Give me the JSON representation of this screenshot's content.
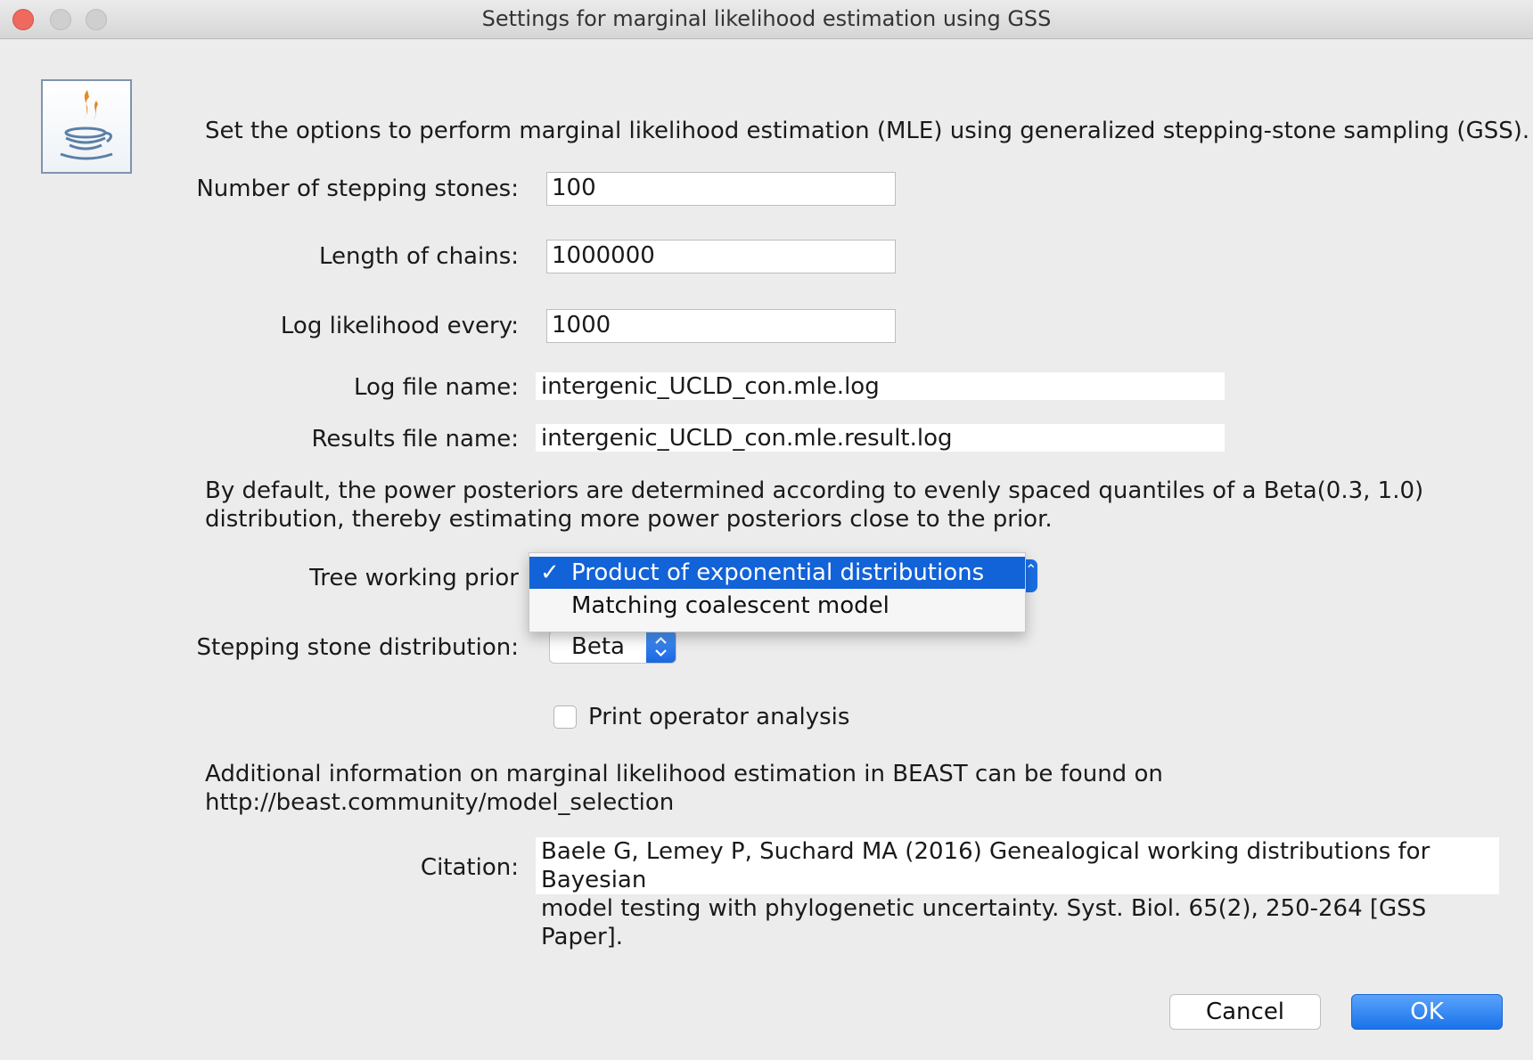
{
  "window": {
    "title": "Settings for marginal likelihood estimation using GSS"
  },
  "intro": "Set the options to perform marginal likelihood estimation (MLE) using generalized stepping-stone sampling (GSS).",
  "fields": {
    "stepping_stones": {
      "label": "Number of stepping stones:",
      "value": "100"
    },
    "chain_length": {
      "label": "Length of chains:",
      "value": "1000000"
    },
    "log_every": {
      "label": "Log likelihood every:",
      "value": "1000"
    },
    "log_file": {
      "label": "Log file name:",
      "value": "intergenic_UCLD_con.mle.log"
    },
    "results_file": {
      "label": "Results file name:",
      "value": "intergenic_UCLD_con.mle.result.log"
    }
  },
  "default_note": {
    "line1": "By default, the power posteriors are determined according to evenly spaced quantiles of a Beta(0.3, 1.0)",
    "line2": "distribution, thereby estimating more power posteriors close to the prior."
  },
  "tree_prior": {
    "label": "Tree working prior",
    "options": [
      {
        "check": "✓",
        "label": "Product of exponential distributions"
      },
      {
        "check": "",
        "label": "Matching coalescent model"
      }
    ]
  },
  "stepping_distribution": {
    "label": "Stepping stone distribution:",
    "value": "Beta"
  },
  "print_operator": {
    "label": "Print operator analysis",
    "checked": false
  },
  "additional_info": {
    "line1": "Additional information on marginal likelihood estimation in BEAST can be found on",
    "line2": "http://beast.community/model_selection"
  },
  "citation": {
    "label": "Citation:",
    "line1": "Baele G, Lemey P, Suchard MA (2016) Genealogical working distributions for Bayesian",
    "line2": "model testing with phylogenetic uncertainty. Syst. Biol. 65(2), 250-264 [GSS Paper]."
  },
  "buttons": {
    "cancel": "Cancel",
    "ok": "OK"
  },
  "colors": {
    "accent": "#1a6fe6",
    "selection": "#1262d8",
    "window_bg": "#ececec"
  }
}
